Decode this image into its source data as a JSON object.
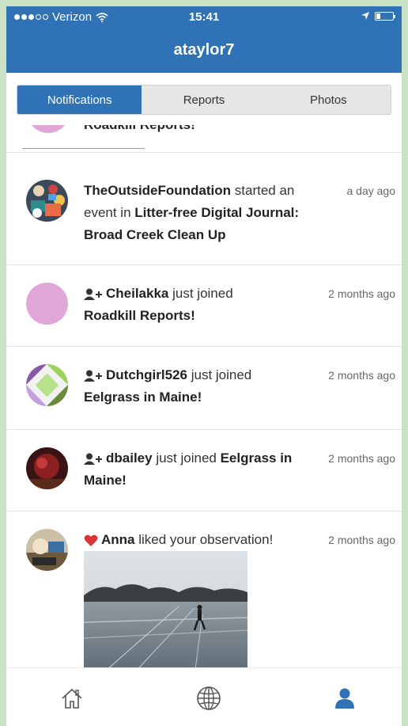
{
  "status": {
    "carrier": "Verizon",
    "time": "15:41"
  },
  "header": {
    "title": "ataylor7"
  },
  "tabs": [
    {
      "label": "Notifications",
      "active": true
    },
    {
      "label": "Reports",
      "active": false
    },
    {
      "label": "Photos",
      "active": false
    }
  ],
  "feed": {
    "partial_text": "Roadkill Reports!",
    "items": [
      {
        "actor": "TheOutsideFoundation",
        "mid1": " started an event in ",
        "target": "Litter-free Digital Journal: Broad Creek Clean Up",
        "time": "a day ago",
        "icon": "none"
      },
      {
        "actor": "Cheilakka",
        "mid1": " just joined ",
        "target": "Roadkill Reports!",
        "time": "2 months ago",
        "icon": "add-user-icon"
      },
      {
        "actor": "Dutchgirl526",
        "mid1": " just joined ",
        "target": "Eelgrass in Maine!",
        "time": "2 months ago",
        "icon": "add-user-icon"
      },
      {
        "actor": "dbailey",
        "mid1": " just joined ",
        "target": "Eelgrass in Maine!",
        "time": "2 months ago",
        "icon": "add-user-icon"
      },
      {
        "actor": "Anna",
        "mid1": " liked your observation!",
        "target": "",
        "time": "2 months ago",
        "icon": "heart-icon"
      }
    ]
  },
  "colors": {
    "primary": "#2f72b6",
    "heart": "#d9343a"
  },
  "nav": [
    "home-icon",
    "globe-icon",
    "profile-icon"
  ]
}
